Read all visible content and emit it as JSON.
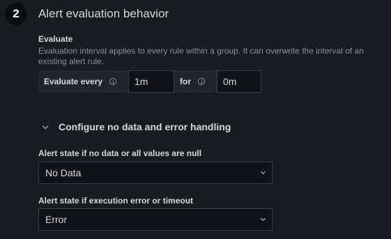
{
  "section": {
    "step_number": "2",
    "title": "Alert evaluation behavior"
  },
  "evaluate": {
    "label": "Evaluate",
    "description": "Evaluation interval applies to every rule within a group. It can overwrite the interval of an existing alert rule.",
    "every_label": "Evaluate every",
    "every_value": "1m",
    "for_label": "for",
    "for_value": "0m"
  },
  "no_data_error": {
    "toggle_label": "Configure no data and error handling",
    "no_data_label": "Alert state if no data or all values are null",
    "no_data_value": "No Data",
    "exec_error_label": "Alert state if execution error or timeout",
    "exec_error_value": "Error"
  }
}
